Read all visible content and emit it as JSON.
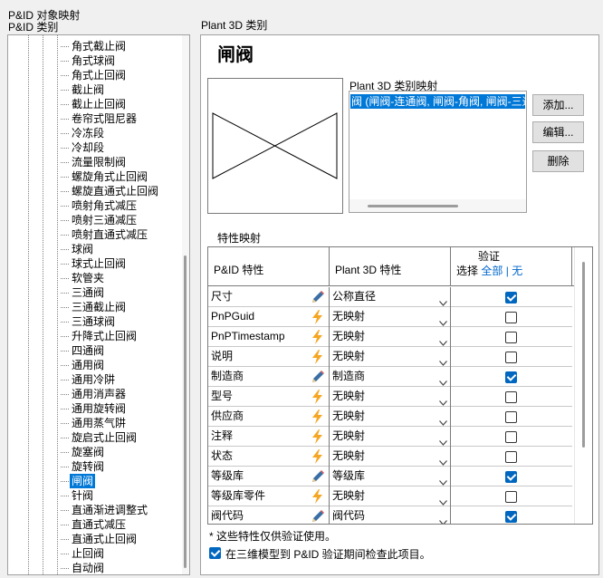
{
  "labels": {
    "pid_object_mapping": "P&ID 对象映射",
    "pid_classes": "P&ID 类别",
    "plant3d_classes": "Plant 3D 类别",
    "plant3d_class_mapping": "Plant 3D 类别映射",
    "property_mapping": "特性映射"
  },
  "tree": {
    "items": [
      "角式截止阀",
      "角式球阀",
      "角式止回阀",
      "截止阀",
      "截止止回阀",
      "卷帘式阻尼器",
      "冷冻段",
      "冷却段",
      "流量限制阀",
      "螺旋角式止回阀",
      "螺旋直通式止回阀",
      "喷射角式减压",
      "喷射三通减压",
      "喷射直通式减压",
      "球阀",
      "球式止回阀",
      "软管夹",
      "三通阀",
      "三通截止阀",
      "三通球阀",
      "升降式止回阀",
      "四通阀",
      "通用阀",
      "通用冷阱",
      "通用消声器",
      "通用旋转阀",
      "通用蒸气阱",
      "旋启式止回阀",
      "旋塞阀",
      "旋转阀",
      "闸阀",
      "针阀",
      "直通渐进调整式",
      "直通式减压",
      "直通式止回阀",
      "止回阀",
      "自动阀"
    ],
    "selected_index": 30
  },
  "class_title": "闸阀",
  "mapping_list": {
    "selected_item": "阀 (闸阀-连通阀, 闸阀-角阀, 闸阀-三通"
  },
  "buttons": {
    "add": "添加...",
    "edit": "编辑...",
    "delete": "删除"
  },
  "table": {
    "header_pid": "P&ID 特性",
    "header_p3d": "Plant 3D 特性",
    "header_validate": "验证",
    "select_label": "选择",
    "select_all": "全部",
    "separator": "|",
    "select_none": "无",
    "rows": [
      {
        "pid": "尺寸",
        "icon": "pencil-icon",
        "p3d": "公称直径",
        "checked": true
      },
      {
        "pid": "PnPGuid",
        "icon": "lightning-icon",
        "p3d": "无映射",
        "checked": false
      },
      {
        "pid": "PnPTimestamp",
        "icon": "lightning-icon",
        "p3d": "无映射",
        "checked": false
      },
      {
        "pid": "说明",
        "icon": "lightning-icon",
        "p3d": "无映射",
        "checked": false
      },
      {
        "pid": "制造商",
        "icon": "pencil-icon",
        "p3d": "制造商",
        "checked": true
      },
      {
        "pid": "型号",
        "icon": "lightning-icon",
        "p3d": "无映射",
        "checked": false
      },
      {
        "pid": "供应商",
        "icon": "lightning-icon",
        "p3d": "无映射",
        "checked": false
      },
      {
        "pid": "注释",
        "icon": "lightning-icon",
        "p3d": "无映射",
        "checked": false
      },
      {
        "pid": "状态",
        "icon": "lightning-icon",
        "p3d": "无映射",
        "checked": false
      },
      {
        "pid": "等级库",
        "icon": "pencil-icon",
        "p3d": "等级库",
        "checked": true
      },
      {
        "pid": "等级库零件",
        "icon": "lightning-icon",
        "p3d": "无映射",
        "checked": false
      },
      {
        "pid": "阀代码",
        "icon": "pencil-icon",
        "p3d": "阀代码",
        "checked": true
      }
    ]
  },
  "footnote": "* 这些特性仅供验证使用。",
  "bottom_option": {
    "label": "在三维模型到 P&ID 验证期间检查此项目。",
    "checked": true
  },
  "colors": {
    "selection": "#0078d7",
    "checkbox": "#0067c0",
    "link": "#0066cc",
    "pencil": "#3a6ea5",
    "lightning": "#f5a623"
  }
}
